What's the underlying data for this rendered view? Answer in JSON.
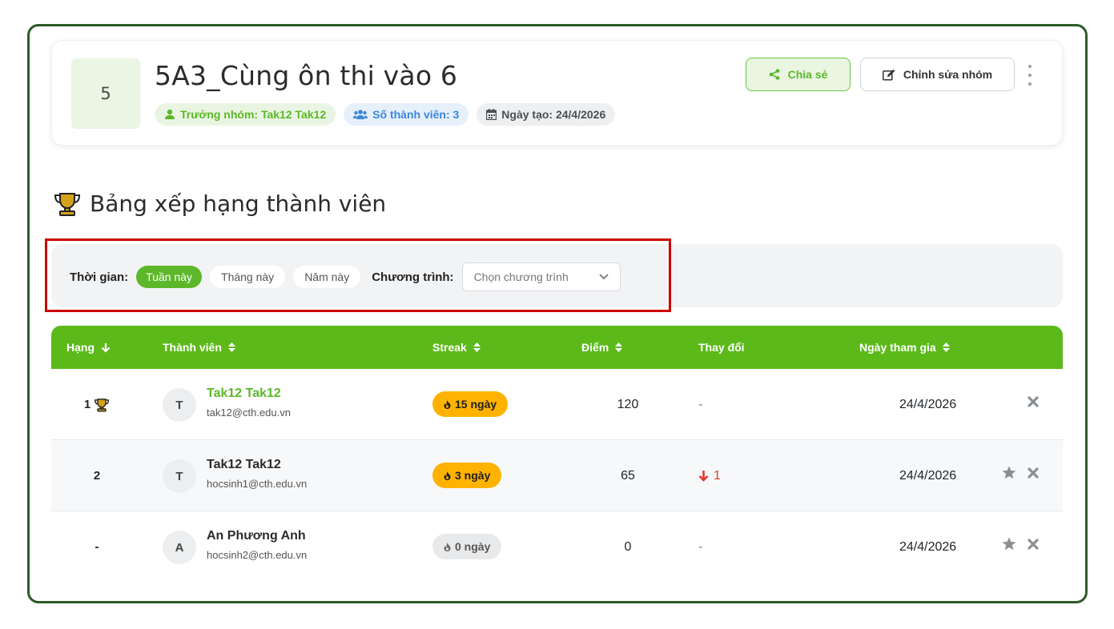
{
  "group": {
    "avatar_text": "5",
    "title": "5A3_Cùng ôn thi vào 6",
    "leader_badge": "Trưởng nhóm: Tak12 Tak12",
    "members_badge": "Số thành viên: 3",
    "created_badge": "Ngày tạo: 24/4/2026",
    "share_label": "Chia sẻ",
    "edit_label": "Chỉnh sửa nhóm"
  },
  "leaderboard": {
    "title": "Bảng xếp hạng thành viên",
    "filter": {
      "time_label": "Thời gian:",
      "time_options": [
        "Tuần này",
        "Tháng này",
        "Năm này"
      ],
      "selected_time": "Tuần này",
      "program_label": "Chương trình:",
      "program_placeholder": "Chọn chương trình"
    },
    "columns": [
      "Hạng",
      "Thành viên",
      "Streak",
      "Điểm",
      "Thay đổi",
      "Ngày tham gia"
    ],
    "rows": [
      {
        "rank": "1",
        "avatar": "T",
        "name": "Tak12 Tak12",
        "email": "tak12@cth.edu.vn",
        "streak": "15 ngày",
        "score": "120",
        "change": "-",
        "joined": "24/4/2026"
      },
      {
        "rank": "2",
        "avatar": "T",
        "name": "Tak12 Tak12",
        "email": "hocsinh1@cth.edu.vn",
        "streak": "3 ngày",
        "score": "65",
        "change": "1",
        "joined": "24/4/2026"
      },
      {
        "rank": "-",
        "avatar": "A",
        "name": "An Phương Anh",
        "email": "hocsinh2@cth.edu.vn",
        "streak": "0 ngày",
        "score": "0",
        "change": "-",
        "joined": "24/4/2026"
      }
    ]
  },
  "colors": {
    "brand_green": "#5cb91a",
    "highlight_red": "#cc0000",
    "streak_orange": "#ffb300",
    "frame_green": "#2d5a27"
  }
}
